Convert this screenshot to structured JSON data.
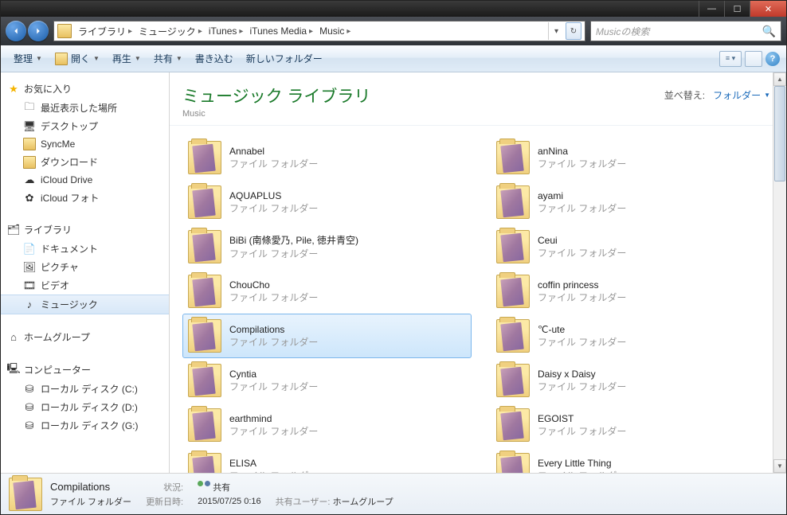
{
  "titlebar": {
    "min": "—",
    "max": "☐",
    "close": "✕"
  },
  "nav": {
    "crumbs": [
      "ライブラリ",
      "ミュージック",
      "iTunes",
      "iTunes Media",
      "Music"
    ],
    "search_placeholder": "Musicの検索"
  },
  "toolbar": {
    "organize": "整理",
    "open": "開く",
    "play": "再生",
    "share": "共有",
    "burn": "書き込む",
    "new_folder": "新しいフォルダー"
  },
  "sidebar": {
    "favorites": {
      "label": "お気に入り",
      "items": [
        "最近表示した場所",
        "デスクトップ",
        "SyncMe",
        "ダウンロード",
        "iCloud Drive",
        "iCloud フォト"
      ]
    },
    "libraries": {
      "label": "ライブラリ",
      "items": [
        "ドキュメント",
        "ピクチャ",
        "ビデオ",
        "ミュージック"
      ]
    },
    "homegroup": {
      "label": "ホームグループ"
    },
    "computer": {
      "label": "コンピューター",
      "items": [
        "ローカル ディスク (C:)",
        "ローカル ディスク (D:)",
        "ローカル ディスク (G:)"
      ]
    }
  },
  "main": {
    "title": "ミュージック ライブラリ",
    "subtitle": "Music",
    "sort_label": "並べ替え:",
    "sort_value": "フォルダー",
    "folder_type": "ファイル フォルダー",
    "folders_left": [
      "Annabel",
      "AQUAPLUS",
      "BiBi (南條愛乃, Pile, 徳井青空)",
      "ChouCho",
      "Compilations",
      "Cyntia",
      "earthmind",
      "ELISA"
    ],
    "folders_right": [
      "anNina",
      "ayami",
      "Ceui",
      "coffin princess",
      "℃-ute",
      "Daisy x Daisy",
      "EGOIST",
      "Every Little Thing"
    ],
    "selected": "Compilations"
  },
  "status": {
    "name": "Compilations",
    "type": "ファイル フォルダー",
    "state_label": "状況:",
    "state_value": "共有",
    "shared_label": "共有ユーザー:",
    "shared_value": "ホームグループ",
    "modified_label": "更新日時:",
    "modified_value": "2015/07/25 0:16"
  }
}
